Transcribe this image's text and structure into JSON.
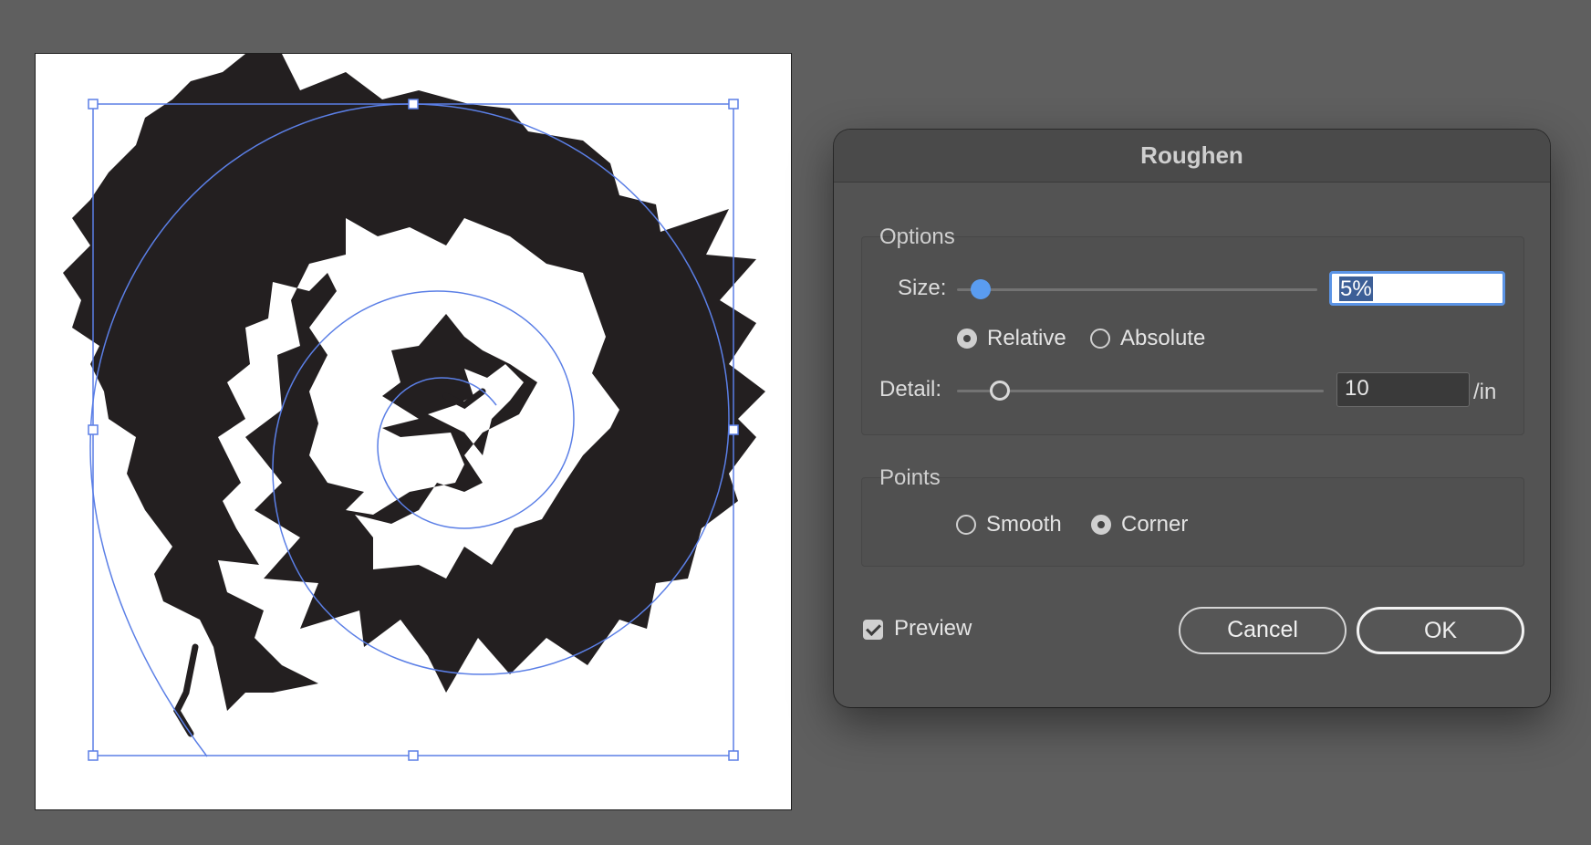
{
  "dialog": {
    "title": "Roughen",
    "options": {
      "label": "Options",
      "size_label": "Size:",
      "size_value": "5%",
      "size_slider_fraction": 0.05,
      "size_mode": "Relative",
      "relative_label": "Relative",
      "absolute_label": "Absolute",
      "detail_label": "Detail:",
      "detail_value": "10",
      "detail_unit": "/in",
      "detail_slider_fraction": 0.1
    },
    "points": {
      "label": "Points",
      "selected": "Corner",
      "smooth_label": "Smooth",
      "corner_label": "Corner"
    },
    "preview_label": "Preview",
    "preview_checked": true,
    "cancel_label": "Cancel",
    "ok_label": "OK"
  },
  "colors": {
    "canvas_bg": "#5f5f5f",
    "artboard_bg": "#ffffff",
    "shape_fill": "#231f20",
    "selection_blue": "#5b7fe6",
    "dialog_bg": "#535353",
    "slider_accent": "#5a9cf0"
  }
}
